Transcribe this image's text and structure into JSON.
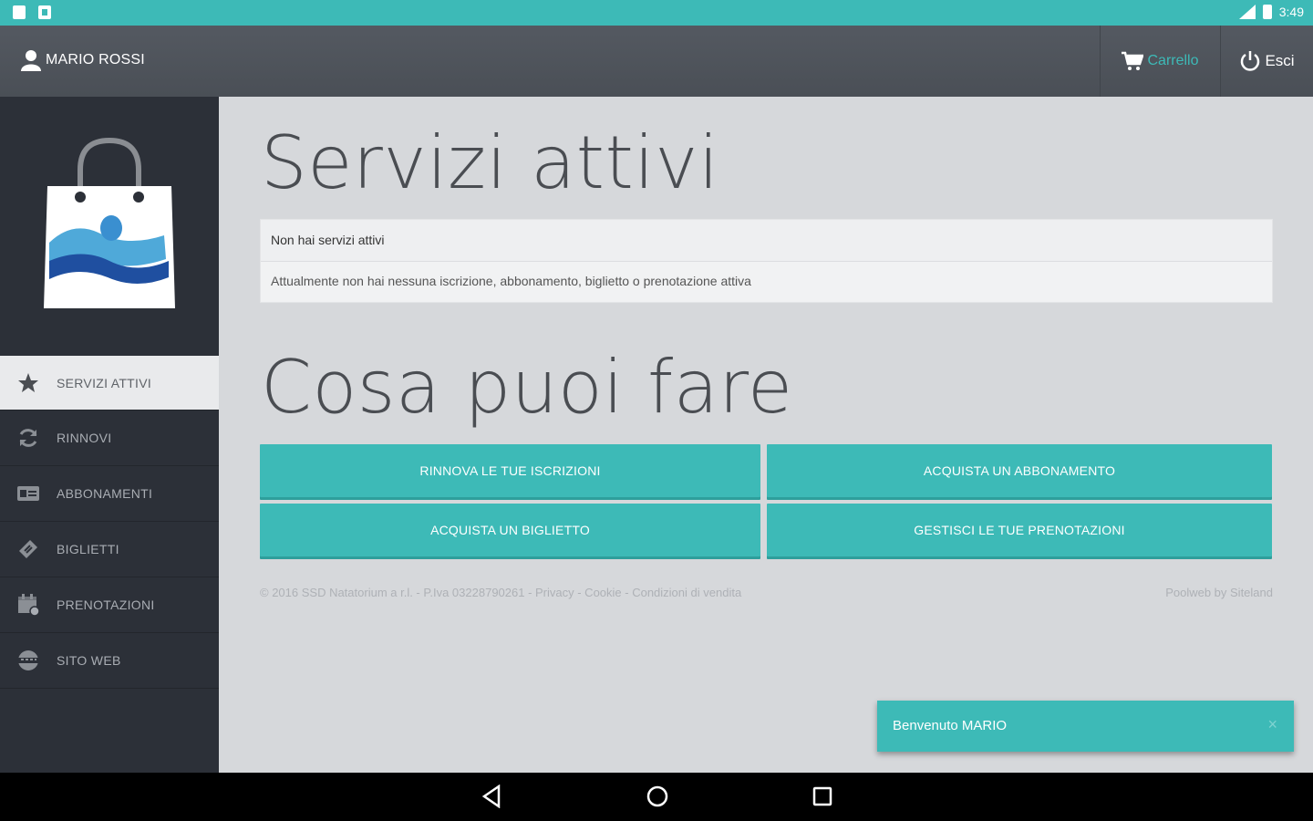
{
  "status_bar": {
    "time": "3:49"
  },
  "header": {
    "user_name": "MARIO ROSSI",
    "cart_label": "Carrello",
    "logout_label": "Esci"
  },
  "sidebar": {
    "items": [
      {
        "label": "SERVIZI ATTIVI",
        "icon": "star-icon",
        "active": true
      },
      {
        "label": "RINNOVI",
        "icon": "refresh-icon",
        "active": false
      },
      {
        "label": "ABBONAMENTI",
        "icon": "card-icon",
        "active": false
      },
      {
        "label": "BIGLIETTI",
        "icon": "ticket-icon",
        "active": false
      },
      {
        "label": "PRENOTAZIONI",
        "icon": "calendar-icon",
        "active": false
      },
      {
        "label": "SITO WEB",
        "icon": "globe-icon",
        "active": false
      }
    ]
  },
  "main": {
    "active_title": "Servizi attivi",
    "panel": {
      "heading": "Non hai servizi attivi",
      "body": "Attualmente non hai nessuna iscrizione, abbonamento, biglietto o prenotazione attiva"
    },
    "actions_title": "Cosa puoi fare",
    "buttons": [
      "RINNOVA LE TUE ISCRIZIONI",
      "ACQUISTA UN ABBONAMENTO",
      "ACQUISTA UN BIGLIETTO",
      "GESTISCI LE TUE PRENOTAZIONI"
    ],
    "footer_left": "© 2016 SSD Natatorium a r.l. - P.Iva 03228790261 - Privacy - Cookie - Condizioni di vendita",
    "footer_right": "Poolweb by Siteland"
  },
  "toast": {
    "message": "Benvenuto MARIO",
    "close": "×"
  },
  "colors": {
    "accent": "#3dbab7",
    "sidebar": "#2c3038",
    "header": "#4f545b",
    "content_bg": "#d6d8db"
  }
}
